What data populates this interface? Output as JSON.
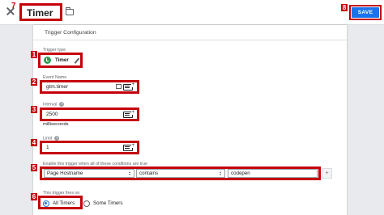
{
  "header": {
    "title": "Timer",
    "save_label": "SAVE",
    "badge_title": "7",
    "badge_save": "8"
  },
  "card": {
    "title": "Trigger Configuration",
    "trigger_type_label": "Trigger type",
    "trigger_type_value": "Timer",
    "event_name_label": "Event Name",
    "event_name_value": "gtm.timer",
    "interval_label": "Interval",
    "interval_value": "2500",
    "interval_units": "milliseconds",
    "limit_label": "Limit",
    "limit_value": "1",
    "condition_label": "Enable this trigger when all of these conditions are true",
    "condition": {
      "variable": "Page Hostname",
      "operator": "contains",
      "value": "codepen"
    },
    "fires_on_label": "This trigger fires on",
    "fires_on_options": [
      "All Timers",
      "Some Timers"
    ],
    "fires_on_selected": "All Timers",
    "plus_label": "+",
    "help_glyph": "?"
  },
  "badges": [
    "1",
    "2",
    "3",
    "4",
    "5",
    "6"
  ],
  "colors": {
    "highlight": "#c5000b",
    "primary": "#1a73e8",
    "timer_icon": "#2e9e57"
  },
  "icons": [
    "close-icon",
    "folder-icon",
    "timer-icon",
    "pencil-icon",
    "variable-picker-icon",
    "help-icon"
  ]
}
